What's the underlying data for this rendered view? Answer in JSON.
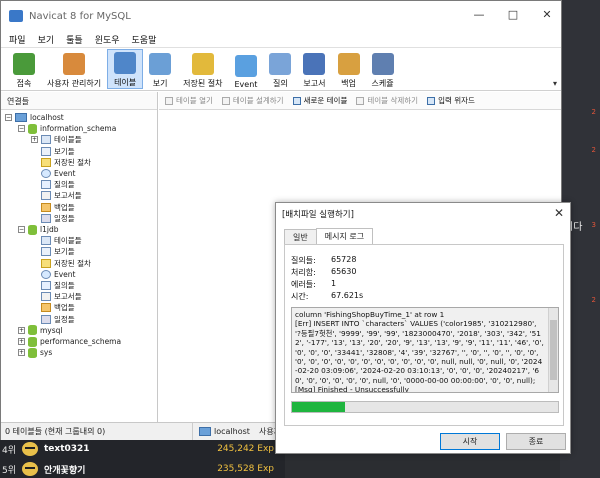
{
  "window": {
    "title": "Navicat 8 for MySQL",
    "controls": [
      "—",
      "□",
      "✕"
    ]
  },
  "menu": [
    "파일",
    "보기",
    "툴틀",
    "윈도우",
    "도움말"
  ],
  "toolbar": [
    {
      "label": "접속",
      "icon": "connect-icon",
      "active": false
    },
    {
      "label": "사용자 관리하기",
      "icon": "user-icon",
      "active": false
    },
    {
      "label": "테이블",
      "icon": "table-icon",
      "active": true
    },
    {
      "label": "보기",
      "icon": "view-icon",
      "active": false
    },
    {
      "label": "저장된 절차",
      "icon": "procedure-icon",
      "active": false
    },
    {
      "label": "Event",
      "icon": "event-icon",
      "active": false
    },
    {
      "label": "질의",
      "icon": "query-icon",
      "active": false
    },
    {
      "label": "보고서",
      "icon": "report-icon",
      "active": false
    },
    {
      "label": "백업",
      "icon": "backup-icon",
      "active": false
    },
    {
      "label": "스케쥴",
      "icon": "schedule-icon",
      "active": false
    }
  ],
  "sidebar": {
    "header": "연결들",
    "tree": [
      {
        "label": "localhost",
        "type": "conn",
        "exp": "−",
        "level": 0,
        "y": 0
      },
      {
        "label": "information_schema",
        "type": "db",
        "exp": "−",
        "level": 1,
        "y": 1
      },
      {
        "label": "테이블들",
        "type": "table",
        "exp": "+",
        "level": 2,
        "y": 2
      },
      {
        "label": "보기들",
        "type": "view",
        "exp": "",
        "level": 2,
        "y": 3
      },
      {
        "label": "저장된 절차",
        "type": "proc",
        "exp": "",
        "level": 2,
        "y": 4
      },
      {
        "label": "Event",
        "type": "event",
        "exp": "",
        "level": 2,
        "y": 5
      },
      {
        "label": "질의들",
        "type": "query",
        "exp": "",
        "level": 2,
        "y": 6
      },
      {
        "label": "보고서들",
        "type": "report",
        "exp": "",
        "level": 2,
        "y": 7
      },
      {
        "label": "백업들",
        "type": "backup",
        "exp": "",
        "level": 2,
        "y": 8
      },
      {
        "label": "일정들",
        "type": "sched",
        "exp": "",
        "level": 2,
        "y": 9
      },
      {
        "label": "l1jdb",
        "type": "db",
        "exp": "−",
        "level": 1,
        "y": 10
      },
      {
        "label": "테이블들",
        "type": "table",
        "exp": "",
        "level": 2,
        "y": 11
      },
      {
        "label": "보기들",
        "type": "view",
        "exp": "",
        "level": 2,
        "y": 12
      },
      {
        "label": "저장된 절차",
        "type": "proc",
        "exp": "",
        "level": 2,
        "y": 13
      },
      {
        "label": "Event",
        "type": "event",
        "exp": "",
        "level": 2,
        "y": 14
      },
      {
        "label": "질의들",
        "type": "query",
        "exp": "",
        "level": 2,
        "y": 15
      },
      {
        "label": "보고서들",
        "type": "report",
        "exp": "",
        "level": 2,
        "y": 16
      },
      {
        "label": "백업들",
        "type": "backup",
        "exp": "",
        "level": 2,
        "y": 17
      },
      {
        "label": "일정들",
        "type": "sched",
        "exp": "",
        "level": 2,
        "y": 18
      },
      {
        "label": "mysql",
        "type": "db",
        "exp": "+",
        "level": 1,
        "y": 19
      },
      {
        "label": "performance_schema",
        "type": "db",
        "exp": "+",
        "level": 1,
        "y": 20
      },
      {
        "label": "sys",
        "type": "db",
        "exp": "+",
        "level": 1,
        "y": 21
      }
    ]
  },
  "object_toolbar": [
    {
      "label": "테이블 열기",
      "enabled": false
    },
    {
      "label": "테이블 설계하기",
      "enabled": false
    },
    {
      "label": "새로운 테이블",
      "enabled": true
    },
    {
      "label": "테이블 삭제하기",
      "enabled": false
    },
    {
      "label": "입력 위자드",
      "enabled": true
    }
  ],
  "status": {
    "left": "0 테이블들 (현재 그룹내의 0)",
    "connection": "localhost",
    "user": "사용자"
  },
  "dialog": {
    "title": "[배치파일 실행하기]",
    "close": "✕",
    "tabs": [
      {
        "label": "일반",
        "active": false
      },
      {
        "label": "메시지 로그",
        "active": true
      }
    ],
    "stats": [
      {
        "label": "질의들:",
        "value": "65728"
      },
      {
        "label": "처리함:",
        "value": "65630"
      },
      {
        "label": "에러들:",
        "value": "1"
      },
      {
        "label": "시간:",
        "value": "67.621s"
      }
    ],
    "log": "column 'FishingShopBuyTime_1' at row 1\n[Err] INSERT INTO `characters` VALUES ('color1985', '310212980', '?등필7헛천', '9999', '99', '99', '1823000470', '2018', '303', '342', '512', '-177', '13', '13', '20', '20', '9', '13', '13', '9', '9', '11', '11', '46', '0', '0', '0', '0', '33441', '32808', '4', '39', '32767', '', '0', '', '0', '', '0', '0', '0', '0', '0', '0', '0', '0', '0', '0', '0', '0', '0', null, null, '0', null, '0', '2024-02-20 03:09:06', '2024-02-20 03:10:13', '0', '0', '0', '20240217', '60', '0', '0', '0', '0', '0', null, '0', '0000-00-00 00:00:00', '0', '0', null);\n[Msg] Finished - Unsuccessfully",
    "progress": 0.2,
    "start_label": "시작",
    "cancel_label": "종료"
  },
  "background": {
    "right_texts": [
      {
        "text": "니다",
        "mark": "3"
      }
    ],
    "right_marks": [
      "2",
      "2",
      "2"
    ],
    "ranking": [
      {
        "rank": "4위",
        "name": "text0321",
        "exp": "245,242 Exp"
      },
      {
        "rank": "5위",
        "name": "안개꽃향기",
        "exp": "235,528 Exp"
      }
    ]
  }
}
